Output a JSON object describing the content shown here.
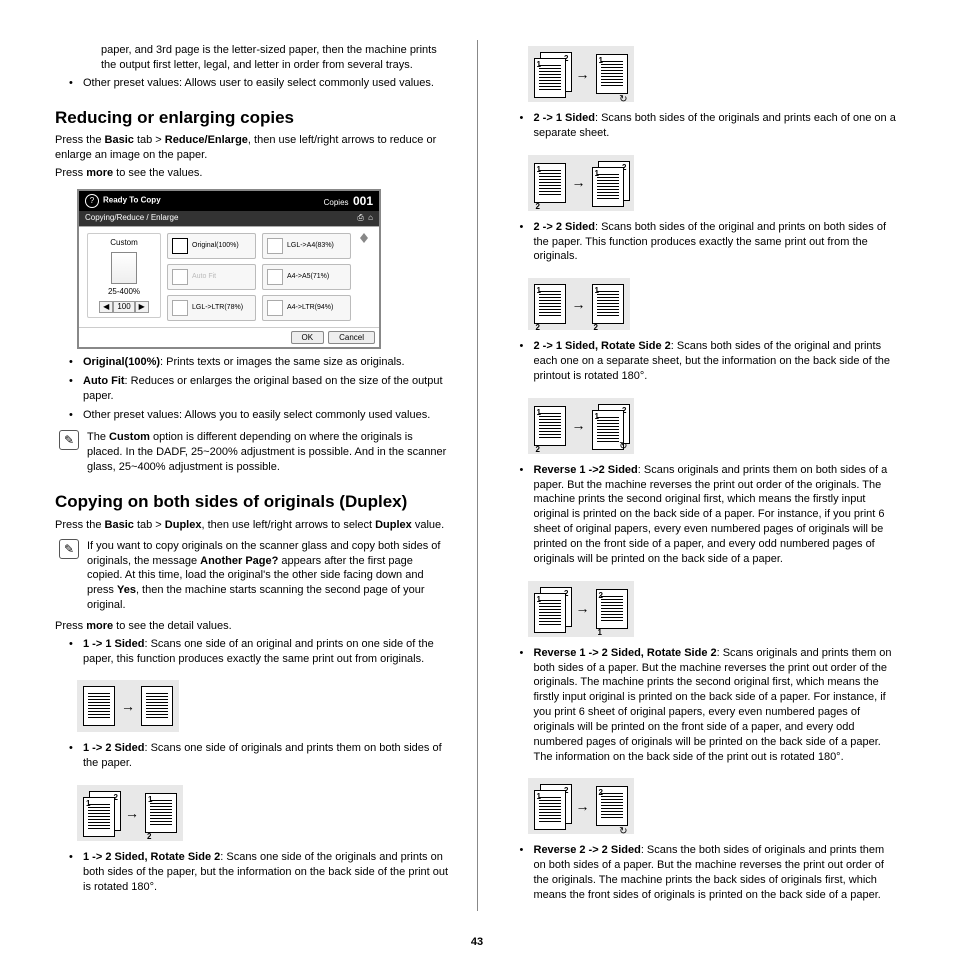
{
  "col1": {
    "opening": {
      "p1": "paper, and 3rd page is the letter-sized paper, then the machine prints the output first letter, legal, and letter in order from several trays.",
      "li_other": "Other preset values: Allows user to easily select commonly used values."
    },
    "h_reduce": "Reducing or enlarging copies",
    "reduce_p1_a": "Press the ",
    "reduce_p1_b": " tab > ",
    "reduce_p1_c": ", then use left/right arrows to reduce or enlarge an image on the paper.",
    "basic": "Basic",
    "reduce_enlarge": "Reduce/Enlarge",
    "more": "more",
    "press_more": " to see the values.",
    "ui": {
      "ready": "Ready To Copy",
      "copies_label": "Copies",
      "copies_val": "001",
      "breadcrumb": "Copying/Reduce / Enlarge",
      "custom": "Custom",
      "range": "25-400%",
      "val": "100",
      "original": "Original(100%)",
      "autofit": "Auto Fit",
      "lgl_ltr": "LGL->LTR(78%)",
      "lgl_a4": "LGL->A4(83%)",
      "a4_a5": "A4->A5(71%)",
      "a4_ltr": "A4->LTR(94%)",
      "ok": "OK",
      "cancel": "Cancel"
    },
    "li1_b": "Original(100%)",
    "li1_t": ": Prints texts or images the same size as originals.",
    "li2_b": "Auto Fit",
    "li2_t": ": Reduces or enlarges the original based on the size of the output paper.",
    "li3": "Other preset values: Allows you to easily select commonly used values.",
    "note1_a": "The ",
    "note1_b": "Custom",
    "note1_c": " option is different depending on where the originals is placed. In the DADF, 25~200% adjustment is possible. And in the scanner glass, 25~400% adjustment is possible.",
    "h_duplex": "Copying on both sides of originals (Duplex)",
    "dup_p1_a": "Press the ",
    "dup_p1_b": " tab > ",
    "dup_p1_c": ", then use left/right arrows to select ",
    "dup_p1_d": " value.",
    "duplex": "Duplex",
    "note2_a": "If you want to copy originals on the scanner glass and copy both sides of originals, the message ",
    "note2_b": "Another Page?",
    "note2_c": " appears after the first page copied. At this time, load the original's the other side facing down and press ",
    "note2_d": "Yes",
    "note2_e": ", then the machine starts scanning the second page of your original.",
    "press_more2": " to see the detail values.",
    "d1_b": "1 -> 1 Sided",
    "d1_t": ": Scans one side of an original and prints on one side of the paper, this function produces exactly the same print out from originals.",
    "d2_b": "1 -> 2 Sided",
    "d2_t": ": Scans one side of originals and prints them on both sides of the paper.",
    "d3_b": "1 -> 2 Sided, Rotate Side 2",
    "d3_t": ": Scans one side of the originals and prints on both sides of the paper, but the information on the back side of the print out is rotated 180°."
  },
  "col2": {
    "e1_b": "2 -> 1 Sided",
    "e1_t": ": Scans both sides of the originals and prints each of one on a separate sheet.",
    "e2_b": "2 -> 2 Sided",
    "e2_t": ": Scans both sides of the original and prints on both sides of the paper. This function produces exactly the same print out from the originals.",
    "e3_b": "2 -> 1 Sided, Rotate Side 2",
    "e3_t": ": Scans both sides of the original and prints each one on a separate sheet, but the information on the back side of the printout is rotated 180°.",
    "e4_b": "Reverse 1 ->2 Sided",
    "e4_t": ": Scans originals and prints them on both sides of a paper. But the machine reverses the print out order of the originals. The machine prints the second original first, which means the firstly input original is printed on the back side of a paper. For instance, if you print 6 sheet of original papers, every even numbered pages of originals will be printed on the front side of a paper, and every odd numbered pages of originals will be printed on the back side of a paper.",
    "e5_b": "Reverse 1 -> 2 Sided, Rotate Side 2",
    "e5_t": ": Scans originals and prints them on both sides of a paper. But the machine reverses the print out order of the originals. The machine prints the second original first, which means the firstly input original is printed on the back side of a paper. For instance, if you print 6 sheet of original papers, every even numbered pages of originals will be printed on the front side of a paper, and every odd numbered pages of originals will be printed on the back side of a paper. The information on the back side of the print out is rotated 180°.",
    "e6_b": "Reverse 2 -> 2 Sided",
    "e6_t": ": Scans the both sides of originals and prints them on both sides of a paper. But the machine reverses the print out order of the originals. The machine prints the back sides of originals first, which means the front sides of originals is printed on the back side of a paper."
  },
  "arrow": "→",
  "page_number": "43"
}
